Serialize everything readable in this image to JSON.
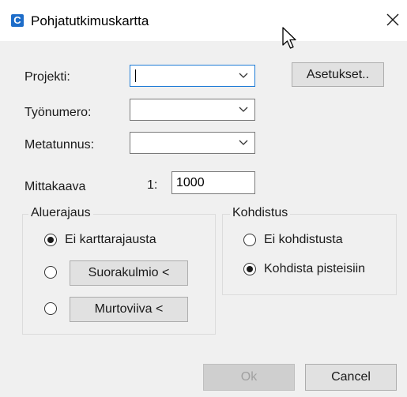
{
  "window": {
    "title": "Pohjatutkimuskartta",
    "app_icon": "C"
  },
  "fields": {
    "projekti_label": "Projekti:",
    "tyonumero_label": "Työnumero:",
    "metatunnus_label": "Metatunnus:",
    "projekti_value": "",
    "tyonumero_value": "",
    "metatunnus_value": ""
  },
  "buttons": {
    "settings": "Asetukset..",
    "ok": "Ok",
    "cancel": "Cancel"
  },
  "scale": {
    "label": "Mittakaava",
    "prefix": "1:",
    "value": "1000"
  },
  "aluerajaus": {
    "title": "Aluerajaus",
    "option_none": "Ei karttarajausta",
    "rectangle_button": "Suorakulmio <",
    "polyline_button": "Murtoviiva <",
    "selected": "Ei karttarajausta"
  },
  "kohdistus": {
    "title": "Kohdistus",
    "option_none": "Ei kohdistusta",
    "option_points": "Kohdista pisteisiin",
    "selected": "Kohdista pisteisiin"
  },
  "icons": {
    "app": "app-c-icon",
    "close": "close-icon",
    "cursor": "mouse-pointer-icon",
    "dropdown": "chevron-down-icon"
  },
  "colors": {
    "accent": "#0078d7",
    "window_bg": "#f0f0f0",
    "app_icon": "#1e6dc9"
  }
}
